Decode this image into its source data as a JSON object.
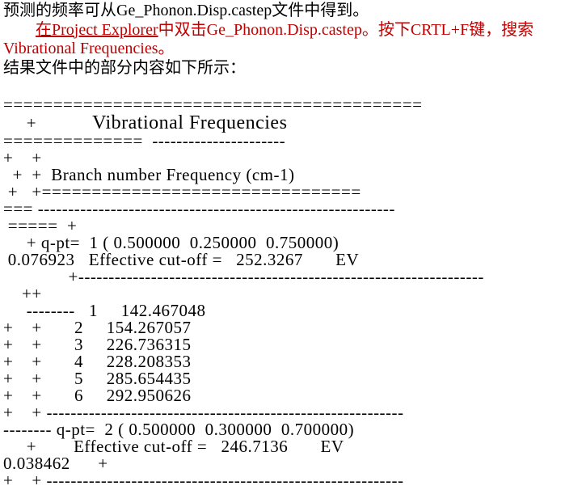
{
  "intro": {
    "line1_a": "预测的频率可从Ge_Phonon.Disp.castep文件中得到。",
    "line2_indent": "　　",
    "line2_red_a": "在Project Explorer",
    "line2_red_b": "中双击Ge_Phonon.Disp.castep。按下CRTL+F键，搜索Vibrational Frequencies。",
    "line3": "结果文件中的部分内容如下所示："
  },
  "freq_title": "Vibrational Frequencies",
  "branch_header": "Branch number Frequency (cm-1)",
  "qpt1": {
    "label": "q-pt=",
    "num": "1",
    "coords": "( 0.500000  0.250000  0.750000)",
    "weight": "0.076923",
    "cutoff_label": "Effective cut-off =",
    "cutoff_val": "252.3267",
    "unit": "EV"
  },
  "branches1": [
    {
      "n": "1",
      "v": "142.467048"
    },
    {
      "n": "2",
      "v": "154.267057"
    },
    {
      "n": "3",
      "v": "226.736315"
    },
    {
      "n": "4",
      "v": "228.208353"
    },
    {
      "n": "5",
      "v": "285.654435"
    },
    {
      "n": "6",
      "v": "292.950626"
    }
  ],
  "qpt2": {
    "label": "q-pt=",
    "num": "2",
    "coords": "( 0.500000  0.300000  0.700000)",
    "weight": "0.038462",
    "cutoff_label": "Effective cut-off =",
    "cutoff_val": "246.7136",
    "unit": "EV"
  },
  "eq_long": "==========================================",
  "eq_mid": "==============",
  "eq_short": "========",
  "dash_long": "-------------------------------------------------------------------",
  "dash_mid": "-----------------------------------------------------------",
  "dash_short": "--------"
}
